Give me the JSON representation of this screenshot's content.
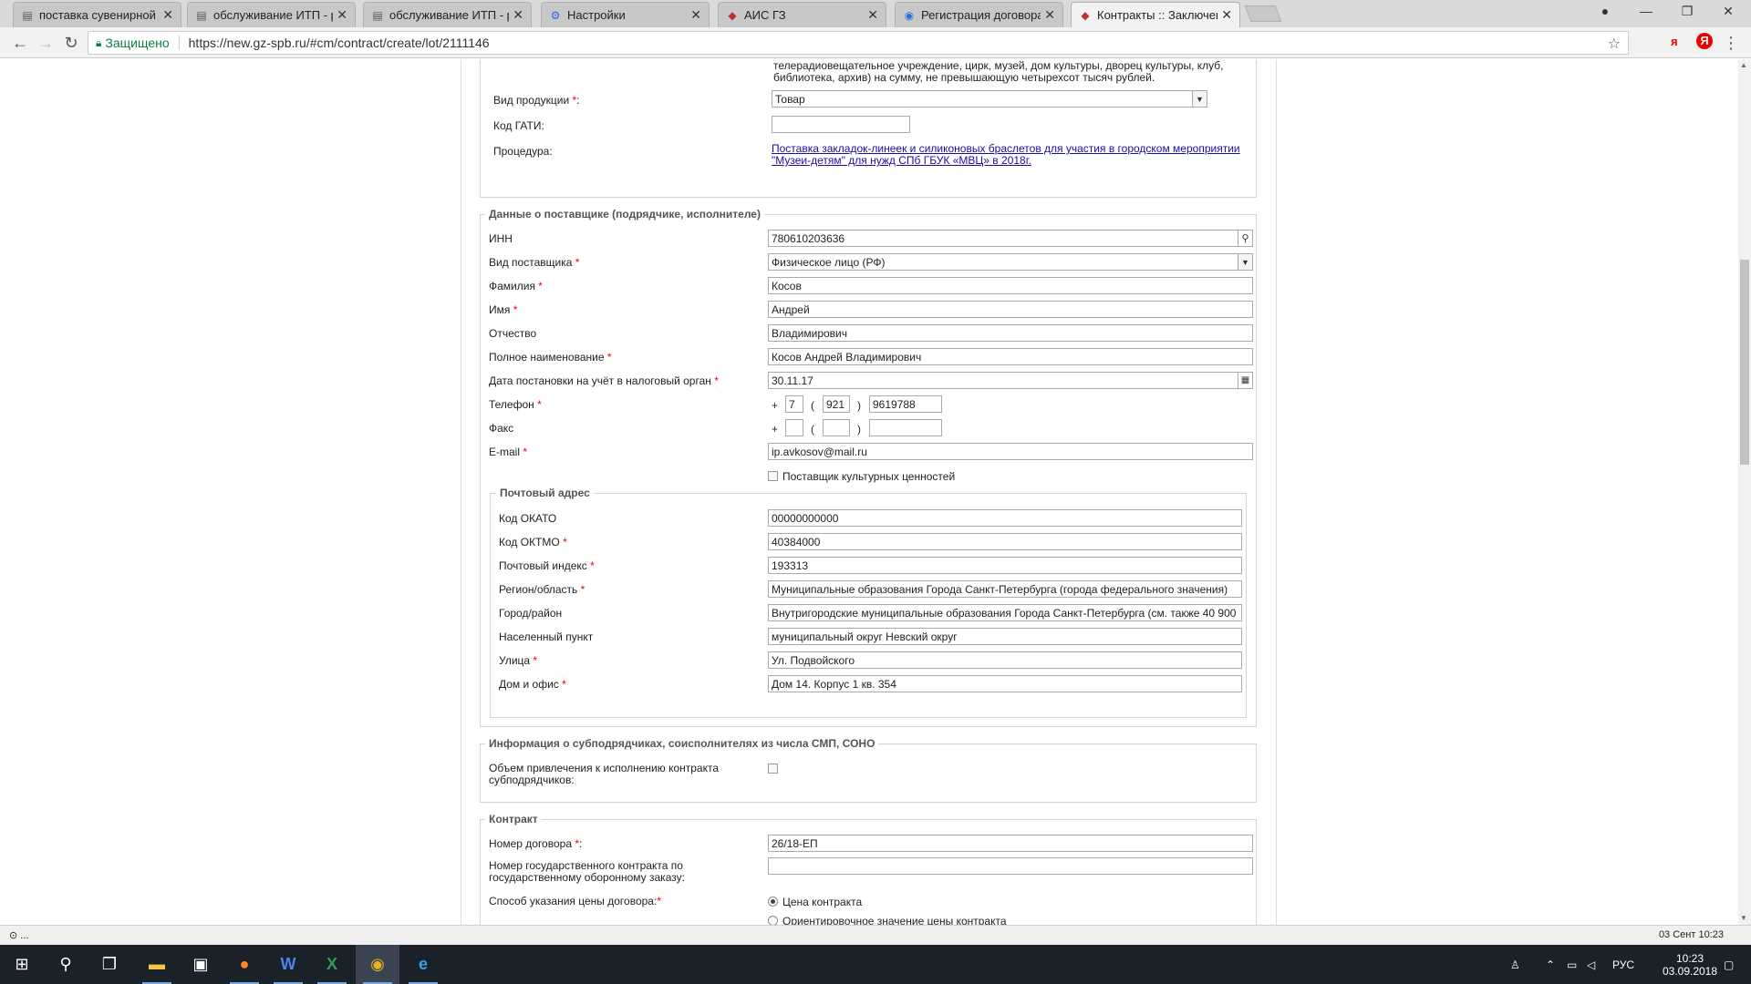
{
  "browser": {
    "tabs": [
      {
        "label": "поставка сувенирной пр",
        "icon": "document-icon"
      },
      {
        "label": "обслуживание ИТП - ре",
        "icon": "document-icon"
      },
      {
        "label": "обслуживание ИТП - ре",
        "icon": "document-icon"
      },
      {
        "label": "Настройки",
        "icon": "gear-icon"
      },
      {
        "label": "АИС ГЗ",
        "icon": "app-icon"
      },
      {
        "label": "Регистрация договора |",
        "icon": "globe-icon"
      },
      {
        "label": "Контракты :: Заключени",
        "icon": "app-icon"
      }
    ],
    "close_glyph": "✕",
    "secure_label": "Защищено",
    "url": "https://new.gz-spb.ru/#cm/contract/create/lot/2111146",
    "ext_ya": "я",
    "ext_y": "Я"
  },
  "procurement": {
    "top_text_1": "телерадиовещательное учреждение, цирк, музей, дом культуры, дворец культуры, клуб,",
    "top_text_2": "библиотека, архив) на сумму, не превышающую четырехсот тысяч рублей.",
    "product_type_label": "Вид продукции ",
    "product_type_value": "Товар",
    "gati_label": "Код ГАТИ:",
    "procedure_label": "Процедура:",
    "procedure_link_1": "Поставка закладок-линеек и силиконовых браслетов для участия в городском мероприятии",
    "procedure_link_2": "\"Музеи-детям\" для нужд СПб ГБУК «МВЦ» в 2018г."
  },
  "supplier": {
    "legend": "Данные о поставщике (подрядчике, исполнителе)",
    "inn_label": "ИНН",
    "inn": "780610203636",
    "type_label": "Вид поставщика ",
    "type": "Физическое лицо (РФ)",
    "surname_label": "Фамилия ",
    "surname": "Косов",
    "name_label": "Имя ",
    "name": "Андрей",
    "patronymic_label": "Отчество",
    "patronymic": "Владимирович",
    "fullname_label": "Полное наименование ",
    "fullname": "Косов Андрей Владимирович",
    "taxdate_label": "Дата постановки на учёт в налоговый орган ",
    "taxdate": "30.11.17",
    "phone_label": "Телефон ",
    "phone_plus": "+",
    "phone_country": "7",
    "phone_code": "921",
    "phone_number": "9619788",
    "paren_open": "(",
    "paren_close": ")",
    "fax_label": "Факс",
    "email_label": "E-mail ",
    "email": "ip.avkosov@mail.ru",
    "cultural_label": "Поставщик культурных ценностей"
  },
  "address": {
    "legend": "Почтовый адрес",
    "okato_label": "Код ОКАТО",
    "okato": "00000000000",
    "oktmo_label": "Код ОКТМО ",
    "oktmo": "40384000",
    "zip_label": "Почтовый индекс ",
    "zip": "193313",
    "region_label": "Регион/область ",
    "region": "Муниципальные образования Города Санкт-Петербурга (города федерального значения)",
    "city_label": "Город/район",
    "city": "Внутригородские муниципальные образования Города Санкт-Петербурга (см. также 40 900",
    "locality_label": "Населенный пункт",
    "locality": "муниципальный округ Невский округ",
    "street_label": "Улица ",
    "street": "Ул. Подвойского",
    "house_label": "Дом и офис ",
    "house": "Дом 14. Корпус 1 кв. 354"
  },
  "subcontract": {
    "legend": "Информация о субподрядчиках, соисполнителях из числа СМП, СОНО",
    "label_1": "Объем привлечения к исполнению контракта",
    "label_2": "субподрядчиков:"
  },
  "contract": {
    "legend": "Контракт",
    "number_label": "Номер договора ",
    "number": "26/18-ЕП",
    "gov_label_1": "Номер государственного контракта по",
    "gov_label_2": "государственному оборонному заказу:",
    "price_method_label": "Способ указания цены договора:",
    "price_option_1": "Цена контракта",
    "price_option_2": "Ориентировочное значение цены контракта"
  },
  "common": {
    "req_star": "*",
    "colon": ":"
  },
  "statusbar": {
    "left": "⊙ ...",
    "right": "03 Сент 10:23"
  },
  "taskbar": {
    "time": "10:23",
    "date": "03.09.2018",
    "lang": "РУС"
  },
  "colors": {
    "required": "#e00000",
    "link": "#1a0dab",
    "secure": "#0b8043"
  }
}
